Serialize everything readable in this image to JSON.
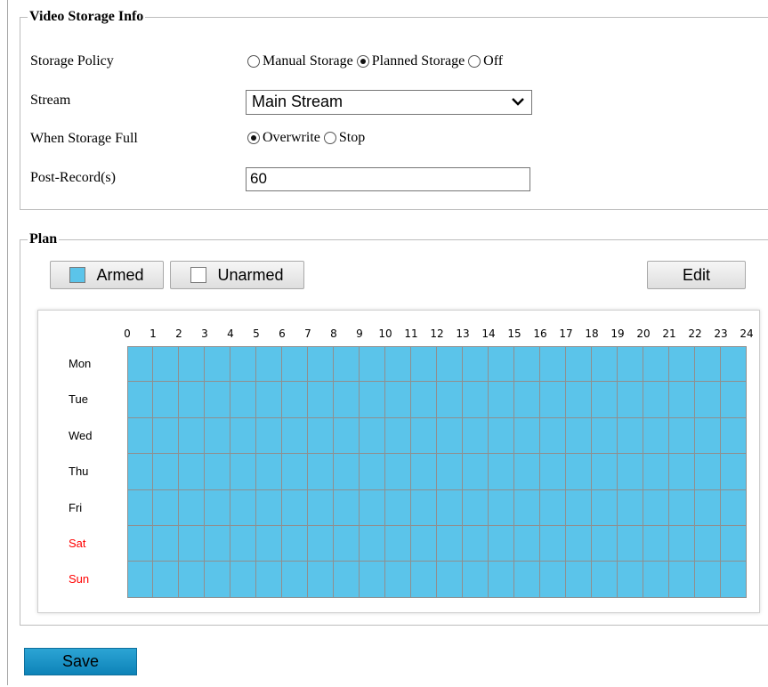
{
  "storage_info": {
    "legend": "Video Storage Info",
    "storage_policy": {
      "label": "Storage Policy",
      "options": [
        "Manual Storage",
        "Planned Storage",
        "Off"
      ],
      "selected": "Planned Storage"
    },
    "stream": {
      "label": "Stream",
      "value": "Main Stream"
    },
    "when_full": {
      "label": "When Storage Full",
      "options": [
        "Overwrite",
        "Stop"
      ],
      "selected": "Overwrite"
    },
    "post_record": {
      "label": "Post-Record(s)",
      "value": "60"
    }
  },
  "plan": {
    "legend": "Plan",
    "armed_label": "Armed",
    "unarmed_label": "Unarmed",
    "edit_label": "Edit",
    "hours": [
      "0",
      "1",
      "2",
      "3",
      "4",
      "5",
      "6",
      "7",
      "8",
      "9",
      "10",
      "11",
      "12",
      "13",
      "14",
      "15",
      "16",
      "17",
      "18",
      "19",
      "20",
      "21",
      "22",
      "23",
      "24"
    ],
    "days": [
      {
        "label": "Mon",
        "weekend": false
      },
      {
        "label": "Tue",
        "weekend": false
      },
      {
        "label": "Wed",
        "weekend": false
      },
      {
        "label": "Thu",
        "weekend": false
      },
      {
        "label": "Fri",
        "weekend": false
      },
      {
        "label": "Sat",
        "weekend": true
      },
      {
        "label": "Sun",
        "weekend": true
      }
    ],
    "schedule_state": "all-armed"
  },
  "save_label": "Save",
  "colors": {
    "armed": "#5bc4ea",
    "unarmed": "#ffffff",
    "weekend_text": "#ff0000",
    "save_button": "#1b94c8"
  }
}
